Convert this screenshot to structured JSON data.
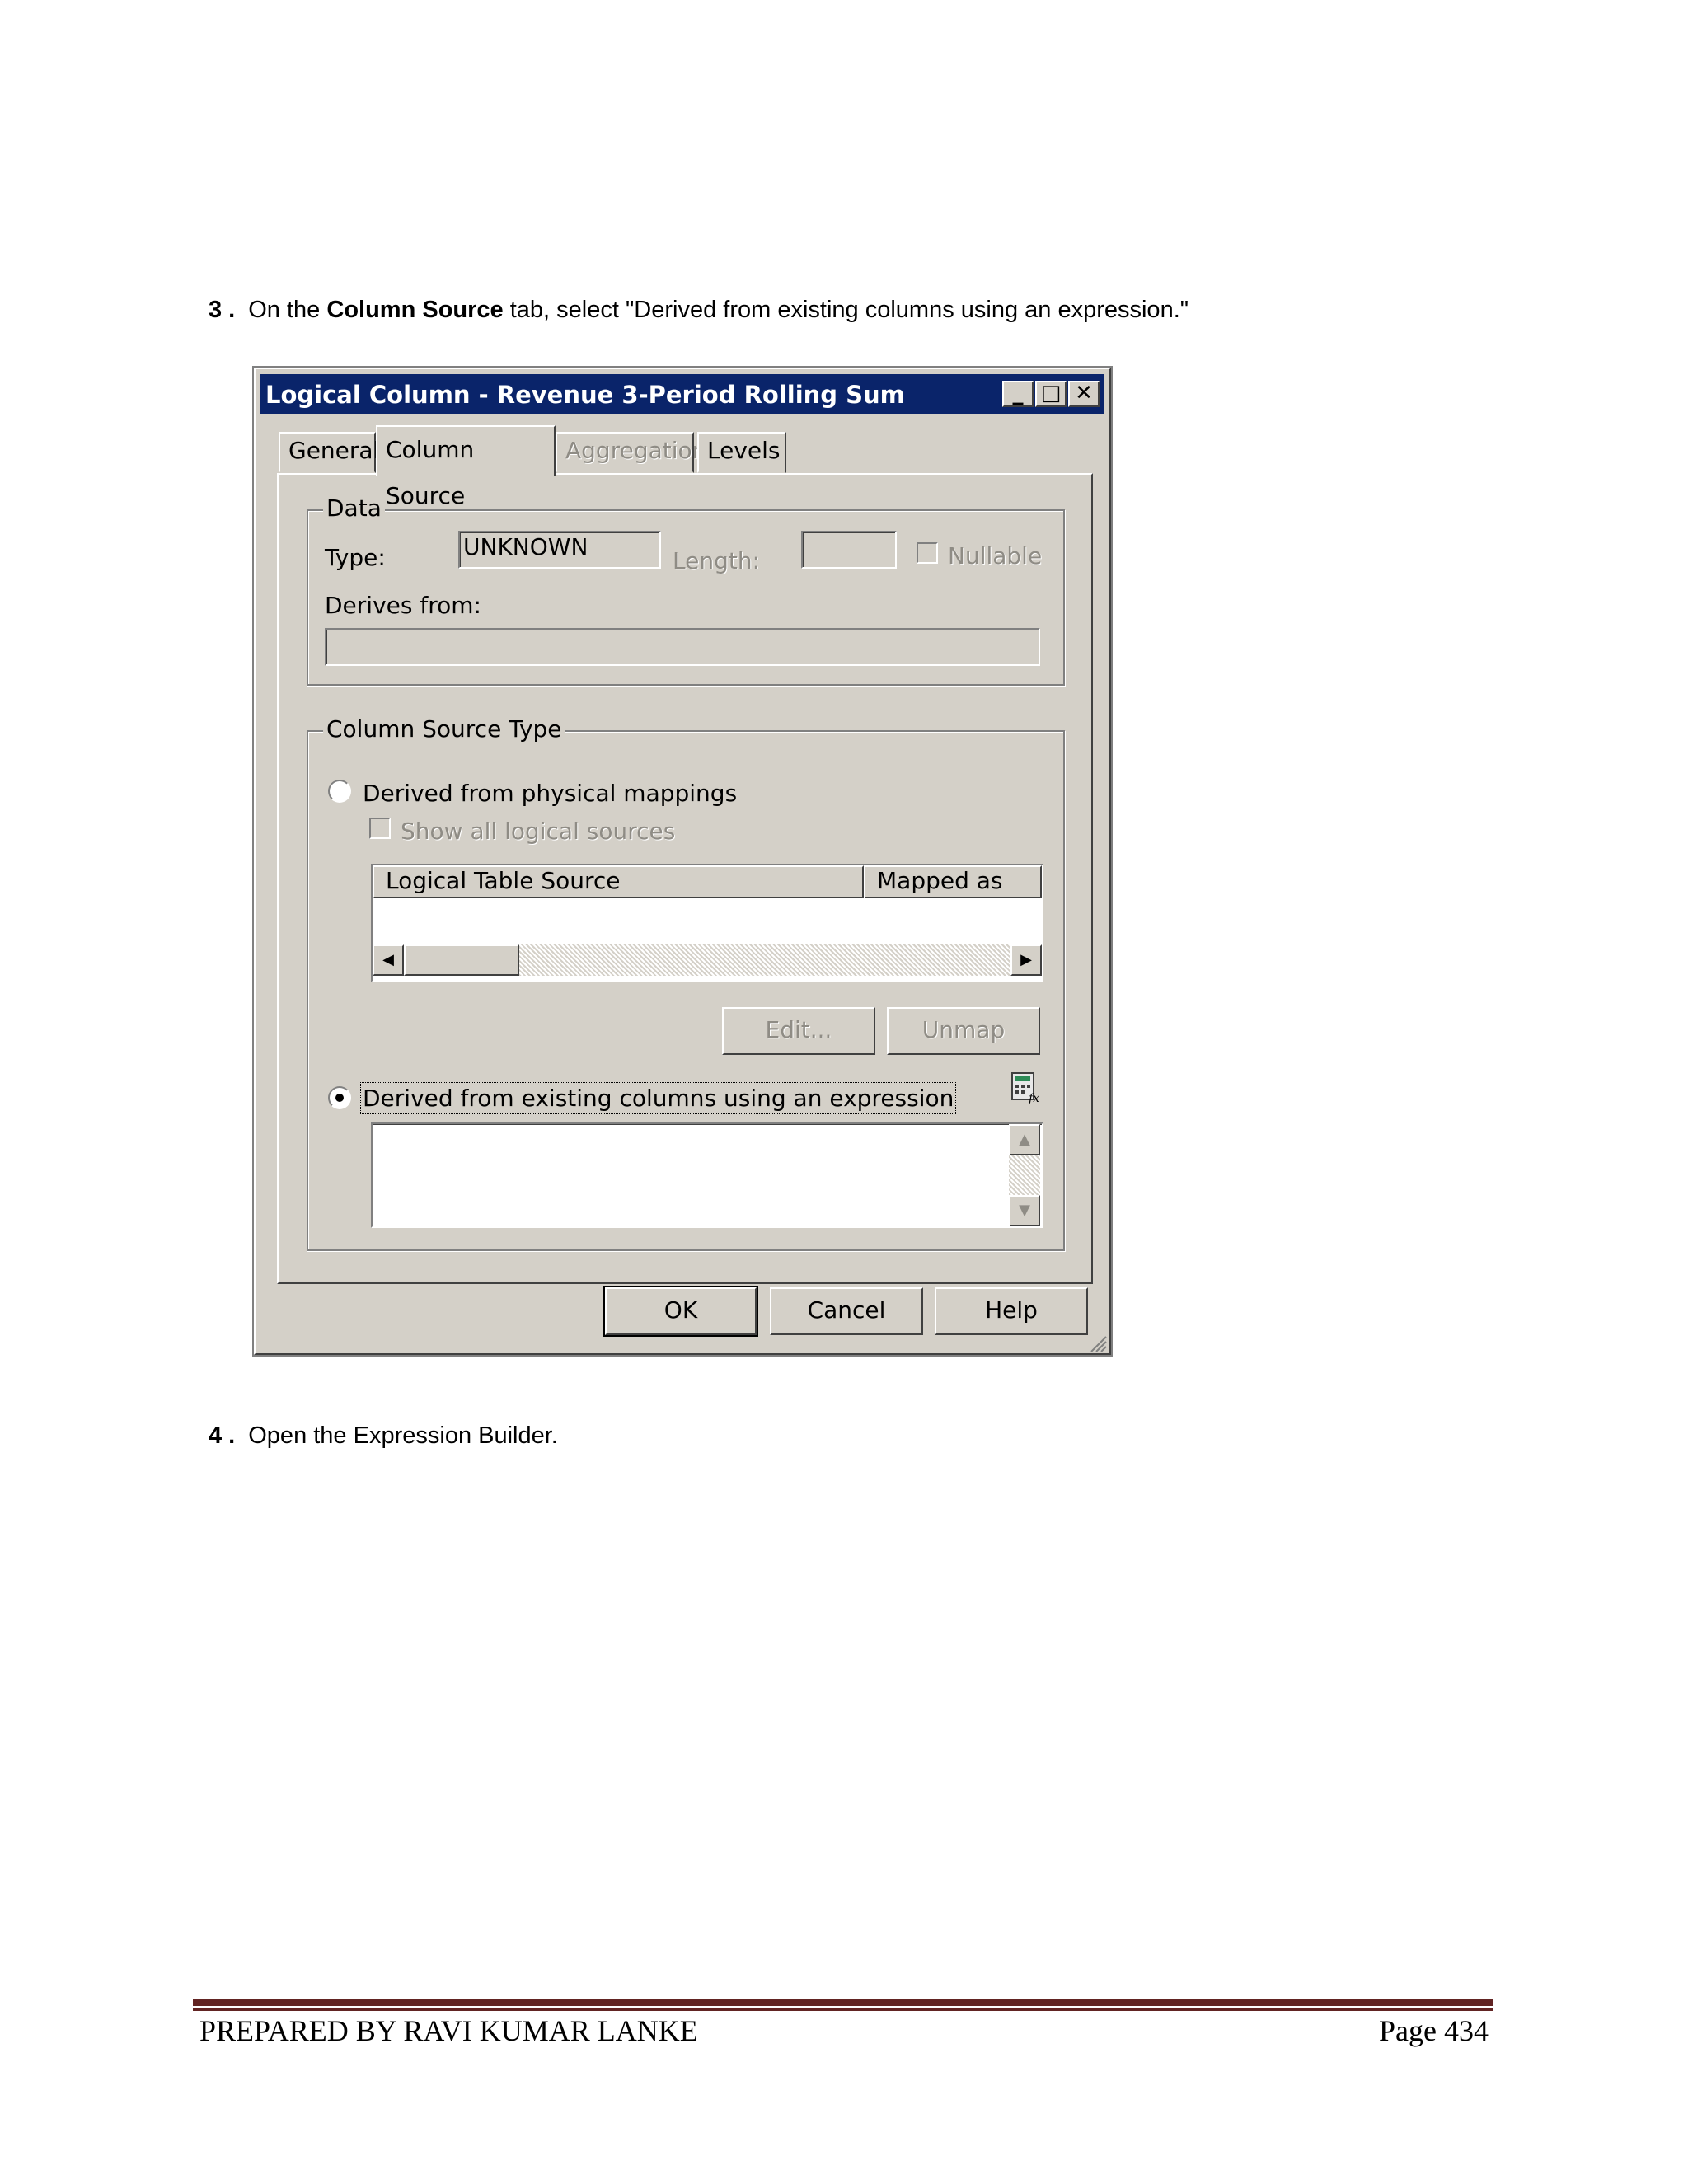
{
  "step3": {
    "number": "3 .",
    "pre": "On the ",
    "bold": "Column Source",
    "post": " tab, select \"Derived from existing columns using an expression.\""
  },
  "dialog": {
    "title": "Logical Column - Revenue 3-Period Rolling Sum",
    "title_buttons": [
      "_",
      "□",
      "✕"
    ],
    "tabs": [
      "General",
      "Column Source",
      "Aggregation",
      "Levels"
    ],
    "active_tab": "Column Source",
    "data_group": {
      "label": "Data",
      "type_label": "Type:",
      "type_value": "UNKNOWN",
      "length_label": "Length:",
      "length_value": "",
      "nullable_label": "Nullable",
      "derives_from_label": "Derives from:",
      "derives_from_value": ""
    },
    "source_group": {
      "label": "Column Source Type",
      "physical_radio_label": "Derived from physical mappings",
      "physical_selected": false,
      "show_all_label": "Show all logical sources",
      "columns": [
        "Logical Table Source",
        "Mapped as"
      ],
      "edit_button": "Edit...",
      "unmap_button": "Unmap",
      "expression_radio_label": "Derived from existing columns using an expression",
      "expression_selected": true,
      "expression_value": "",
      "expression_builder_icon": "expression-builder-icon"
    },
    "buttons": {
      "ok": "OK",
      "cancel": "Cancel",
      "help": "Help"
    }
  },
  "step4": {
    "number": "4 .",
    "text": "Open the Expression Builder."
  },
  "footer": {
    "left": "PREPARED BY RAVI KUMAR LANKE",
    "right": "Page 434"
  },
  "colors": {
    "titlebar": "#0a246a",
    "dialog_face": "#d4d0c8",
    "footer_rule": "#622423"
  }
}
